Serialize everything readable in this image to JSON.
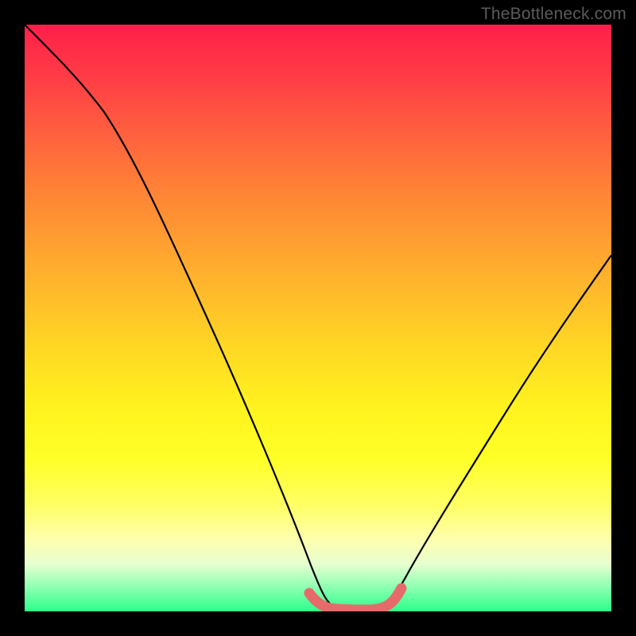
{
  "watermark": "TheBottleneck.com",
  "chart_data": {
    "type": "line",
    "title": "",
    "xlabel": "",
    "ylabel": "",
    "xlim": [
      0,
      100
    ],
    "ylim": [
      0,
      100
    ],
    "series": [
      {
        "name": "bottleneck-curve",
        "x": [
          0,
          5,
          10,
          15,
          20,
          25,
          30,
          35,
          40,
          45,
          48,
          50,
          52,
          55,
          58,
          62,
          65,
          70,
          75,
          80,
          85,
          90,
          95,
          100
        ],
        "y": [
          100,
          95,
          89,
          82,
          73,
          62,
          50,
          38,
          26,
          12,
          4,
          1,
          0,
          0,
          0,
          1,
          4,
          11,
          20,
          29,
          38,
          46,
          53,
          60
        ]
      },
      {
        "name": "valley-highlight",
        "x": [
          48,
          50,
          52,
          55,
          58,
          60,
          62
        ],
        "y": [
          3,
          1,
          0,
          0,
          0,
          1,
          3
        ]
      }
    ],
    "background_gradient_stops": [
      {
        "pos": 0,
        "color": "#ff1f4a"
      },
      {
        "pos": 8,
        "color": "#ff3946"
      },
      {
        "pos": 18,
        "color": "#ff5e3f"
      },
      {
        "pos": 28,
        "color": "#ff8236"
      },
      {
        "pos": 38,
        "color": "#ffa230"
      },
      {
        "pos": 48,
        "color": "#ffc229"
      },
      {
        "pos": 58,
        "color": "#ffe022"
      },
      {
        "pos": 66,
        "color": "#fff41f"
      },
      {
        "pos": 74,
        "color": "#ffff27"
      },
      {
        "pos": 82,
        "color": "#ffff66"
      },
      {
        "pos": 88,
        "color": "#fdffb0"
      },
      {
        "pos": 92,
        "color": "#e6ffd0"
      },
      {
        "pos": 96,
        "color": "#8affb0"
      },
      {
        "pos": 100,
        "color": "#2bff8a"
      }
    ],
    "curve_color": "#000000",
    "highlight_color": "#e76a6a"
  }
}
